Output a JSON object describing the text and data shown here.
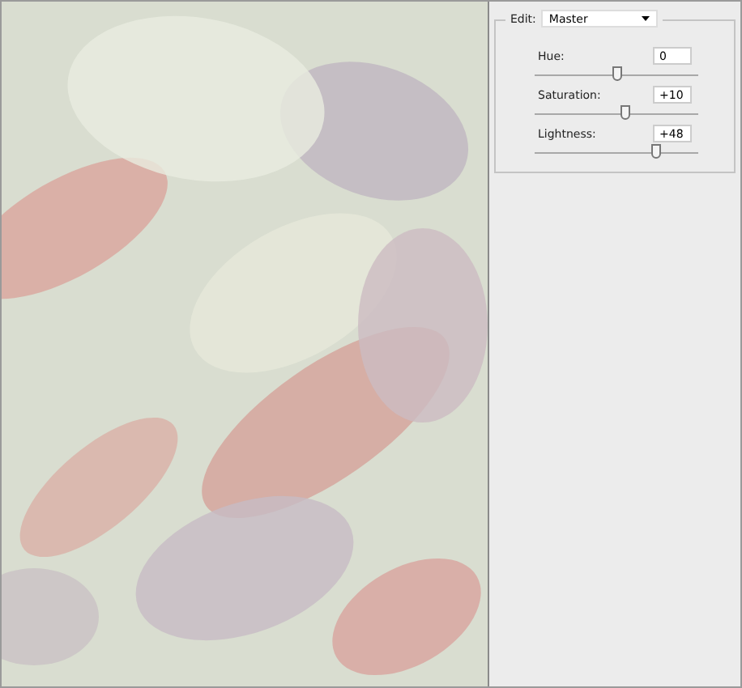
{
  "panel": {
    "edit_label": "Edit:",
    "edit_value": "Master",
    "sliders": [
      {
        "label": "Hue:",
        "value": "0",
        "level": 0.5
      },
      {
        "label": "Saturation:",
        "value": "+10",
        "level": 0.55
      },
      {
        "label": "Lightness:",
        "value": "+48",
        "level": 0.74
      }
    ]
  }
}
